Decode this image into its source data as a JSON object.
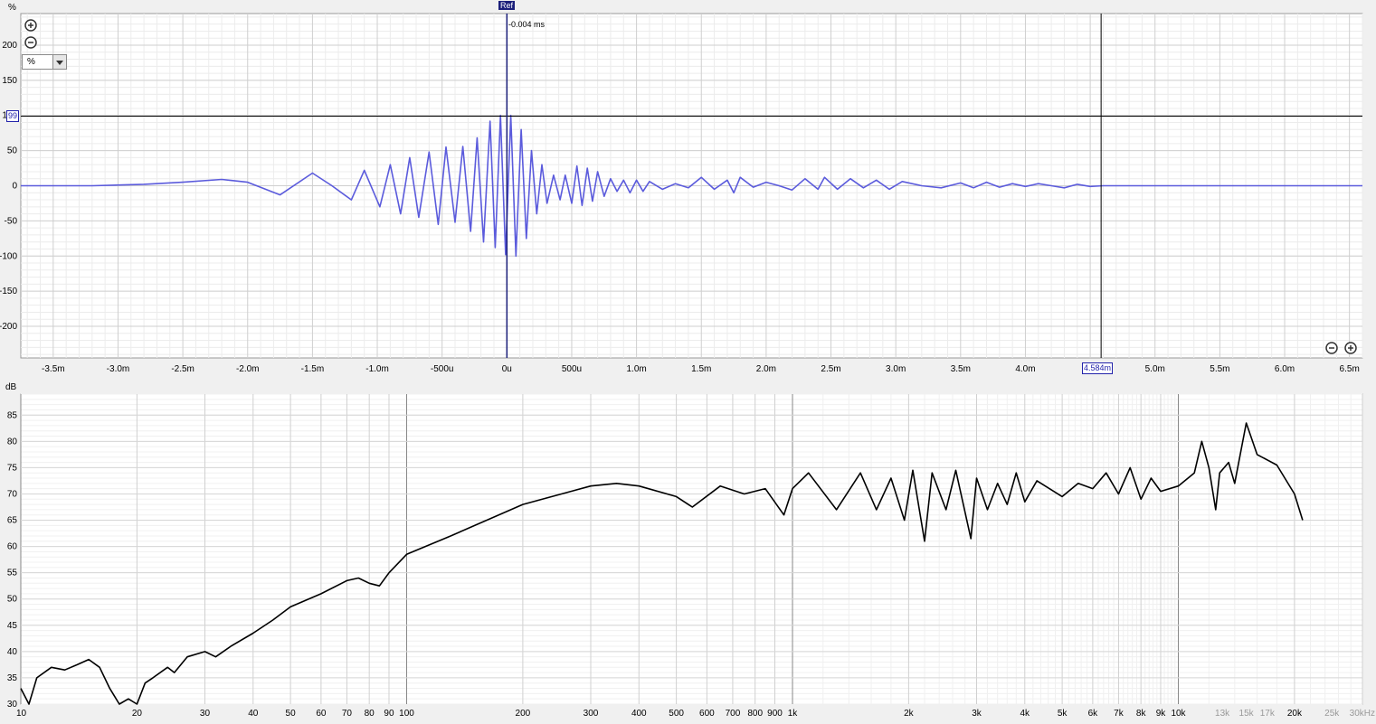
{
  "impulse_panel": {
    "unit_label": "%",
    "unit_select": "%",
    "ref_label": "Ref",
    "ref_delay": "-0.004 ms",
    "h_cursor_value": "99",
    "v_cursor_value": "4.584m",
    "colors": {
      "trace": "#5b5bdc",
      "ref_line": "#1b1f7a",
      "cursor": "#000000",
      "plot_bg": "#ffffff",
      "grid": "#d4d4d4"
    },
    "icons": [
      "zoom-in-icon",
      "zoom-out-icon"
    ]
  },
  "spectrum_panel": {
    "unit_label": "dB",
    "colors": {
      "trace": "#000000"
    }
  },
  "chart_data": [
    {
      "type": "line",
      "name": "impulse-response",
      "xlabel": "",
      "ylabel": "%",
      "xlim": [
        -3.75,
        6.6
      ],
      "ylim": [
        -245,
        245
      ],
      "x_ticks": [
        -3.5,
        -3.0,
        -2.5,
        -2.0,
        -1.5,
        -1.0,
        -0.5,
        0,
        0.5,
        1.0,
        1.5,
        2.0,
        2.5,
        3.0,
        3.5,
        4.0,
        5.0,
        5.5,
        6.0,
        6.5
      ],
      "x_tick_labels": [
        "-3.5m",
        "-3.0m",
        "-2.5m",
        "-2.0m",
        "-1.5m",
        "-1.0m",
        "-500u",
        "0u",
        "500u",
        "1.0m",
        "1.5m",
        "2.0m",
        "2.5m",
        "3.0m",
        "3.5m",
        "4.0m",
        "5.0m",
        "5.5m",
        "6.0m",
        "6.5m"
      ],
      "y_ticks": [
        200,
        150,
        100,
        50,
        0,
        -50,
        -100,
        -150,
        -200
      ],
      "y_tick_labels": [
        "200",
        "150",
        "100",
        "50",
        "0",
        "-50",
        "-100",
        "-150",
        "-200"
      ],
      "ref_x": 0.0,
      "cursor_x": 4.584,
      "cursor_y": 99,
      "points": [
        [
          -3.75,
          0
        ],
        [
          -3.2,
          0
        ],
        [
          -2.8,
          2
        ],
        [
          -2.5,
          5
        ],
        [
          -2.2,
          9
        ],
        [
          -2.0,
          5
        ],
        [
          -1.75,
          -13
        ],
        [
          -1.5,
          18
        ],
        [
          -1.35,
          0
        ],
        [
          -1.2,
          -20
        ],
        [
          -1.1,
          22
        ],
        [
          -0.98,
          -30
        ],
        [
          -0.9,
          30
        ],
        [
          -0.82,
          -40
        ],
        [
          -0.75,
          40
        ],
        [
          -0.68,
          -45
        ],
        [
          -0.6,
          48
        ],
        [
          -0.53,
          -55
        ],
        [
          -0.47,
          55
        ],
        [
          -0.4,
          -52
        ],
        [
          -0.34,
          56
        ],
        [
          -0.28,
          -65
        ],
        [
          -0.23,
          68
        ],
        [
          -0.18,
          -80
        ],
        [
          -0.13,
          92
        ],
        [
          -0.09,
          -88
        ],
        [
          -0.05,
          100
        ],
        [
          -0.01,
          -98
        ],
        [
          0.03,
          100
        ],
        [
          0.07,
          -100
        ],
        [
          0.11,
          80
        ],
        [
          0.15,
          -75
        ],
        [
          0.19,
          50
        ],
        [
          0.23,
          -40
        ],
        [
          0.27,
          30
        ],
        [
          0.31,
          -25
        ],
        [
          0.36,
          15
        ],
        [
          0.41,
          -20
        ],
        [
          0.45,
          15
        ],
        [
          0.5,
          -25
        ],
        [
          0.54,
          28
        ],
        [
          0.58,
          -28
        ],
        [
          0.62,
          25
        ],
        [
          0.66,
          -22
        ],
        [
          0.7,
          20
        ],
        [
          0.75,
          -15
        ],
        [
          0.8,
          10
        ],
        [
          0.85,
          -8
        ],
        [
          0.9,
          8
        ],
        [
          0.95,
          -10
        ],
        [
          1.0,
          8
        ],
        [
          1.05,
          -8
        ],
        [
          1.1,
          6
        ],
        [
          1.2,
          -5
        ],
        [
          1.3,
          3
        ],
        [
          1.4,
          -3
        ],
        [
          1.5,
          12
        ],
        [
          1.6,
          -5
        ],
        [
          1.7,
          8
        ],
        [
          1.75,
          -10
        ],
        [
          1.8,
          12
        ],
        [
          1.9,
          -2
        ],
        [
          2.0,
          5
        ],
        [
          2.1,
          0
        ],
        [
          2.2,
          -6
        ],
        [
          2.3,
          10
        ],
        [
          2.4,
          -5
        ],
        [
          2.45,
          12
        ],
        [
          2.55,
          -5
        ],
        [
          2.65,
          10
        ],
        [
          2.75,
          -3
        ],
        [
          2.85,
          8
        ],
        [
          2.95,
          -5
        ],
        [
          3.05,
          6
        ],
        [
          3.2,
          0
        ],
        [
          3.35,
          -3
        ],
        [
          3.5,
          4
        ],
        [
          3.6,
          -3
        ],
        [
          3.7,
          5
        ],
        [
          3.8,
          -2
        ],
        [
          3.9,
          3
        ],
        [
          4.0,
          -1
        ],
        [
          4.1,
          3
        ],
        [
          4.2,
          0
        ],
        [
          4.3,
          -3
        ],
        [
          4.4,
          2
        ],
        [
          4.5,
          -1
        ],
        [
          4.6,
          0
        ],
        [
          5.0,
          0
        ],
        [
          6.6,
          0
        ]
      ]
    },
    {
      "type": "line",
      "name": "frequency-response",
      "xlabel": "",
      "ylabel": "dB",
      "x_scale": "log",
      "xlim": [
        10,
        30000
      ],
      "ylim": [
        30,
        89
      ],
      "x_tick_labels": [
        "10",
        "20",
        "30",
        "40",
        "50",
        "60",
        "70",
        "80",
        "90",
        "100",
        "200",
        "300",
        "400",
        "500",
        "600",
        "700",
        "800",
        "900",
        "1k",
        "2k",
        "3k",
        "4k",
        "5k",
        "6k",
        "7k",
        "8k",
        "9k",
        "10k",
        "13k",
        "15k",
        "17k",
        "20k",
        "25k",
        "30kHz"
      ],
      "x_tick_values": [
        10,
        20,
        30,
        40,
        50,
        60,
        70,
        80,
        90,
        100,
        200,
        300,
        400,
        500,
        600,
        700,
        800,
        900,
        1000,
        2000,
        3000,
        4000,
        5000,
        6000,
        7000,
        8000,
        9000,
        10000,
        13000,
        15000,
        17000,
        20000,
        25000,
        30000
      ],
      "y_ticks": [
        85,
        80,
        75,
        70,
        65,
        60,
        55,
        50,
        45,
        40,
        35
      ],
      "y_tick_labels": [
        "85",
        "80",
        "75",
        "70",
        "65",
        "60",
        "55",
        "50",
        "45",
        "40",
        "35",
        "30"
      ],
      "points": [
        [
          10,
          33
        ],
        [
          10.5,
          30
        ],
        [
          11,
          35
        ],
        [
          12,
          37
        ],
        [
          13,
          36.5
        ],
        [
          14,
          37.5
        ],
        [
          15,
          38.5
        ],
        [
          16,
          37
        ],
        [
          17,
          33
        ],
        [
          18,
          30
        ],
        [
          19,
          31
        ],
        [
          20,
          30
        ],
        [
          21,
          34
        ],
        [
          22,
          35
        ],
        [
          24,
          37
        ],
        [
          25,
          36
        ],
        [
          27,
          39
        ],
        [
          30,
          40
        ],
        [
          32,
          39
        ],
        [
          35,
          41
        ],
        [
          40,
          43.5
        ],
        [
          45,
          46
        ],
        [
          50,
          48.5
        ],
        [
          60,
          51
        ],
        [
          70,
          53.5
        ],
        [
          75,
          54
        ],
        [
          80,
          53
        ],
        [
          85,
          52.5
        ],
        [
          90,
          55
        ],
        [
          100,
          58.5
        ],
        [
          130,
          62
        ],
        [
          200,
          68
        ],
        [
          300,
          71.5
        ],
        [
          350,
          72
        ],
        [
          400,
          71.5
        ],
        [
          500,
          69.5
        ],
        [
          550,
          67.5
        ],
        [
          650,
          71.5
        ],
        [
          750,
          70
        ],
        [
          850,
          71
        ],
        [
          950,
          66
        ],
        [
          1000,
          71
        ],
        [
          1100,
          74
        ],
        [
          1300,
          67
        ],
        [
          1500,
          74
        ],
        [
          1650,
          67
        ],
        [
          1800,
          73
        ],
        [
          1950,
          65
        ],
        [
          2050,
          74.5
        ],
        [
          2200,
          61
        ],
        [
          2300,
          74
        ],
        [
          2500,
          67
        ],
        [
          2650,
          74.5
        ],
        [
          2900,
          61.5
        ],
        [
          3000,
          73
        ],
        [
          3200,
          67
        ],
        [
          3400,
          72
        ],
        [
          3600,
          68
        ],
        [
          3800,
          74
        ],
        [
          4000,
          68.5
        ],
        [
          4300,
          72.5
        ],
        [
          5000,
          69.5
        ],
        [
          5500,
          72
        ],
        [
          6000,
          71
        ],
        [
          6500,
          74
        ],
        [
          7000,
          70
        ],
        [
          7500,
          75
        ],
        [
          8000,
          69
        ],
        [
          8500,
          73
        ],
        [
          9000,
          70.5
        ],
        [
          10000,
          71.5
        ],
        [
          11000,
          74
        ],
        [
          11500,
          80
        ],
        [
          12000,
          75
        ],
        [
          12500,
          67
        ],
        [
          12800,
          74
        ],
        [
          13500,
          76
        ],
        [
          14000,
          72
        ],
        [
          15000,
          83.5
        ],
        [
          16000,
          77.5
        ],
        [
          18000,
          75.5
        ],
        [
          20000,
          70
        ],
        [
          21000,
          65
        ]
      ]
    }
  ]
}
